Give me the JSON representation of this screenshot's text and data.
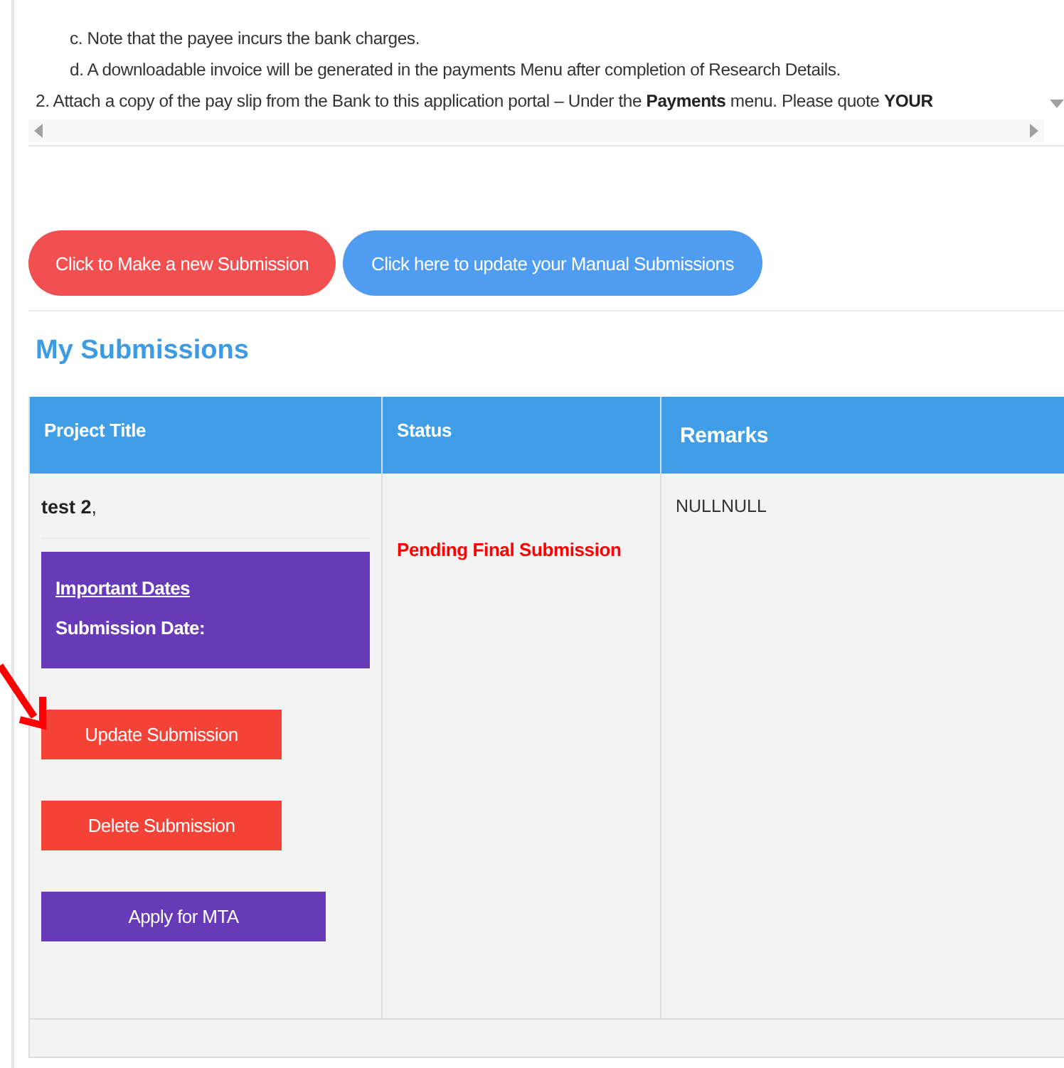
{
  "instructions": [
    {
      "kind": "sub",
      "text": "c. Note that the payee incurs the bank charges."
    },
    {
      "kind": "sub",
      "text": "d. A downloadable invoice will be generated in the payments Menu after completion of Research Details."
    },
    {
      "kind": "main",
      "text": "2. Attach a copy of the pay slip from the Bank to this application portal – Under the **Payments** menu. Please quote **YOUR**"
    }
  ],
  "actions": [
    {
      "kind": "new",
      "label": "Click to Make a new Submission"
    },
    {
      "kind": "manual",
      "label": "Click here to update your Manual Submissions"
    }
  ],
  "heading": "My Submissions",
  "table": {
    "columns": [
      "Project Title",
      "Status",
      "Remarks"
    ],
    "rows": [
      {
        "title": "**test 2**,",
        "dates_link": "Important Dates",
        "dates_label": "Submission Date:",
        "status": "Pending Final Submission",
        "remarks": "NULLNULL",
        "buttons": [
          {
            "kind": "update",
            "label": "Update Submission"
          },
          {
            "kind": "delete",
            "label": "Delete Submission"
          },
          {
            "kind": "mta",
            "label": "Apply for MTA"
          }
        ]
      }
    ]
  }
}
